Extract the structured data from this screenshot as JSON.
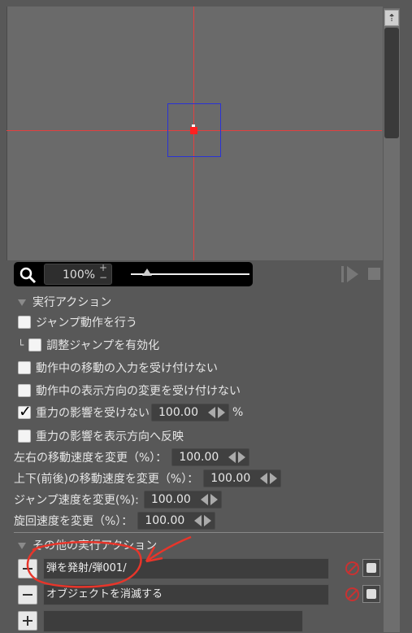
{
  "zoom": {
    "value": "100%",
    "plus": "+",
    "minus": "−",
    "slider_level": 0.1
  },
  "actions_section": {
    "title": "実行アクション",
    "jump": "ジャンプ動作を行う",
    "jump_adjust_mark": "└",
    "jump_adjust": "調整ジャンプを有効化",
    "ignore_move_input": "動作中の移動の入力を受け付けない",
    "ignore_direction_change": "動作中の表示方向の変更を受け付けない",
    "ignore_gravity": "重力の影響を受けない",
    "gravity_value": "100.00",
    "gravity_unit": "%",
    "gravity_reflect": "重力の影響を表示方向へ反映",
    "lr_speed_label": "左右の移動速度を変更（%）：",
    "lr_speed_value": "100.00",
    "ud_speed_label": "上下(前後)の移動速度を変更（%）：",
    "ud_speed_value": "100.00",
    "jump_speed_label": "ジャンプ速度を変更(%):",
    "jump_speed_value": "100.00",
    "turn_speed_label": "旋回速度を変更（%）：",
    "turn_speed_value": "100.00"
  },
  "other_section": {
    "title": "その他の実行アクション",
    "items": [
      "弾を発射/弾001/",
      "オブジェクトを消滅する"
    ]
  },
  "colors": {
    "crosshair": "#e24040",
    "selection_box": "#2a32d6",
    "annotation": "#e8352a"
  }
}
